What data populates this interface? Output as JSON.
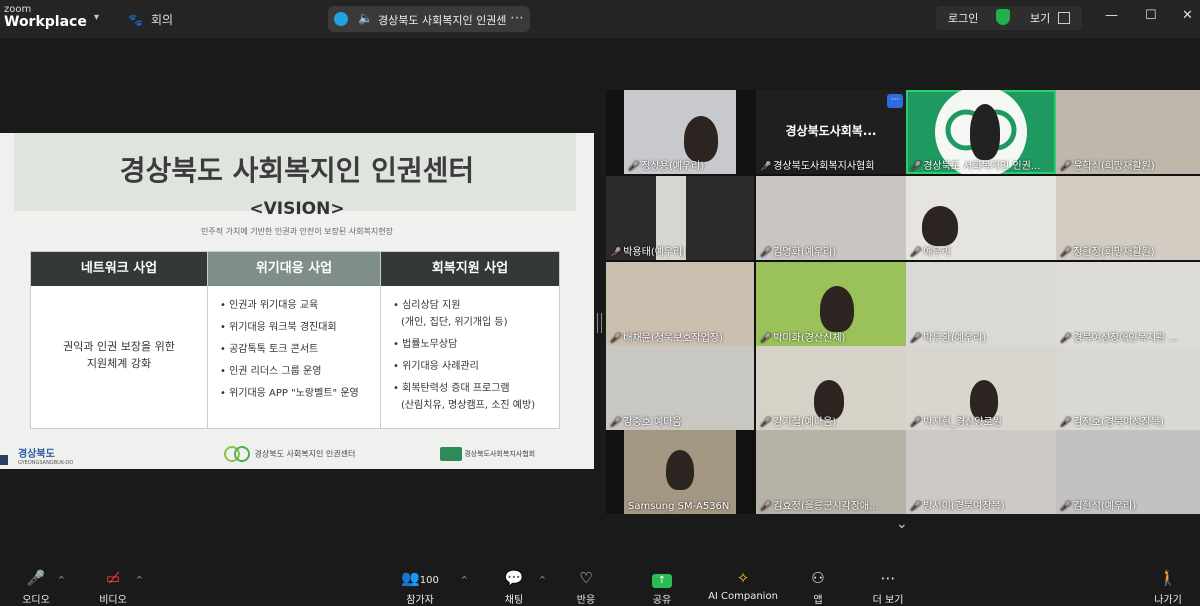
{
  "app": {
    "logo_line1": "zoom",
    "logo_line2": "Workplace"
  },
  "header": {
    "meeting_label": "회의",
    "tab_title": "경상북도 사회복지인 인권센",
    "login": "로그인",
    "view": "보기"
  },
  "slide": {
    "title": "경상북도 사회복지인 인권센터",
    "vision": "<VISION>",
    "vision_sub": "민주적 가치에 기반한 인권과 안전이 보장된 사회복지현장",
    "columns": [
      {
        "header": "네트워크 사업",
        "body_line1": "권익과 인권 보장을 위한",
        "body_line2": "지원체계 강화"
      },
      {
        "header": "위기대응 사업",
        "items": [
          "• 인권과 위기대응 교육",
          "• 위기대응 워크북 경진대회",
          "• 공감톡톡 토크 콘서트",
          "• 인권 리더스 그룹 운영",
          "• 위기대응 APP \"노랑벨트\" 운영"
        ]
      },
      {
        "header": "회복지원 사업",
        "items": [
          "• 심리상담 지원",
          "(개인, 집단, 위기개입 등)",
          "• 법률노무상담",
          "• 위기대응 사례관리",
          "• 회복탄력성 증대 프로그램",
          "(산림치유, 명상캠프, 소진 예방)"
        ]
      }
    ],
    "footer": {
      "left": "경상북도",
      "left_sub": "GYEONGSANGBUK-DO",
      "center": "경상북도 사회복지인 인권센터",
      "right": "경상북도사회복지사협회"
    }
  },
  "participants": [
    "정상용(예우리)",
    "경상북도사회복지사협회",
    "경상북도 사회복지인 인권...",
    "윤학식(희망재활원)",
    "박용태(예우리)",
    "김명화(예우리)",
    "예우리",
    "정현정(희망재활원)",
    "배채윤(청욱보호작업장)",
    "박미화(경산신체)",
    "박두환(예우리)",
    "경북여성장애인복지관 ...",
    "강중호 예다움",
    "강기철(예다움)",
    "박지현_경산양로원",
    "김정호(경북여성장복)",
    "Samsung SM-A536N",
    "김효정(울릉군시각장애...",
    "방서이(경북여장복)",
    "김현석(예우리)"
  ],
  "center_tile_name": "경상북도사회복...",
  "toolbar": {
    "audio": "오디오",
    "video": "비디오",
    "participants": "참가자",
    "participants_count": "100",
    "chat": "채팅",
    "reactions": "반응",
    "share": "공유",
    "ai": "AI Companion",
    "apps": "앱",
    "more": "더 보기",
    "leave": "나가기"
  },
  "colors": {
    "background": "#1a1a1a",
    "active_speaker": "#2ecc71",
    "muted": "#ff4040",
    "share": "#2dbb53",
    "slide_header_dark": "#333a36",
    "slide_header_mid": "#7f8e89"
  }
}
